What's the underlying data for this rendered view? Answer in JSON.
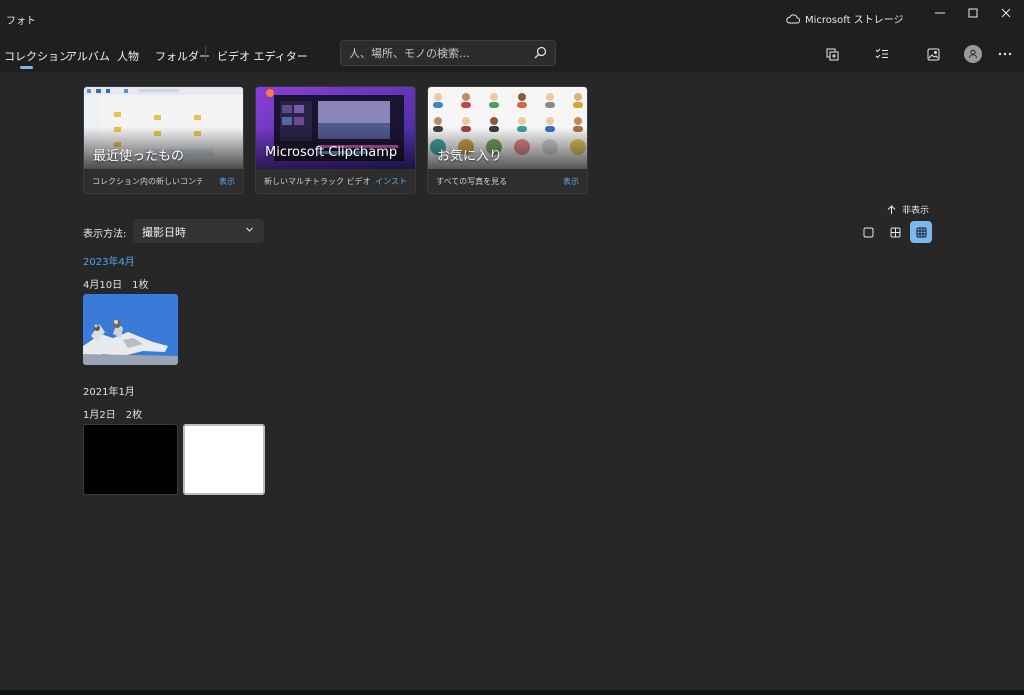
{
  "app": {
    "title": "フォト"
  },
  "storage": {
    "label": "Microsoft ストレージ"
  },
  "nav": {
    "collection": "コレクション",
    "album": "アルバム",
    "people": "人物",
    "folder": "フォルダー",
    "video_editor": "ビデオ エディター"
  },
  "search": {
    "placeholder": "人、場所、モノの検索..."
  },
  "cards": [
    {
      "title": "最近使ったもの",
      "subtitle": "コレクション内の新しいコンテ...",
      "link": "表示"
    },
    {
      "title": "Microsoft Clipchamp",
      "subtitle": "新しいマルチトラック ビデオ エ...",
      "link": "インスト"
    },
    {
      "title": "お気に入り",
      "subtitle": "すべての写真を見る",
      "link": "表示"
    }
  ],
  "sort": {
    "label": "表示方法:",
    "value": "撮影日時"
  },
  "hide": {
    "label": "非表示"
  },
  "groups": [
    {
      "month": "2023年4月",
      "day": "4月10日",
      "count": "1枚"
    },
    {
      "month": "2021年1月",
      "day": "1月2日",
      "count": "2枚"
    }
  ],
  "colors": {
    "accent": "#7ab8f0",
    "link": "#5aa9f0",
    "month_active": "#4ea3ee",
    "background": "#272727"
  }
}
